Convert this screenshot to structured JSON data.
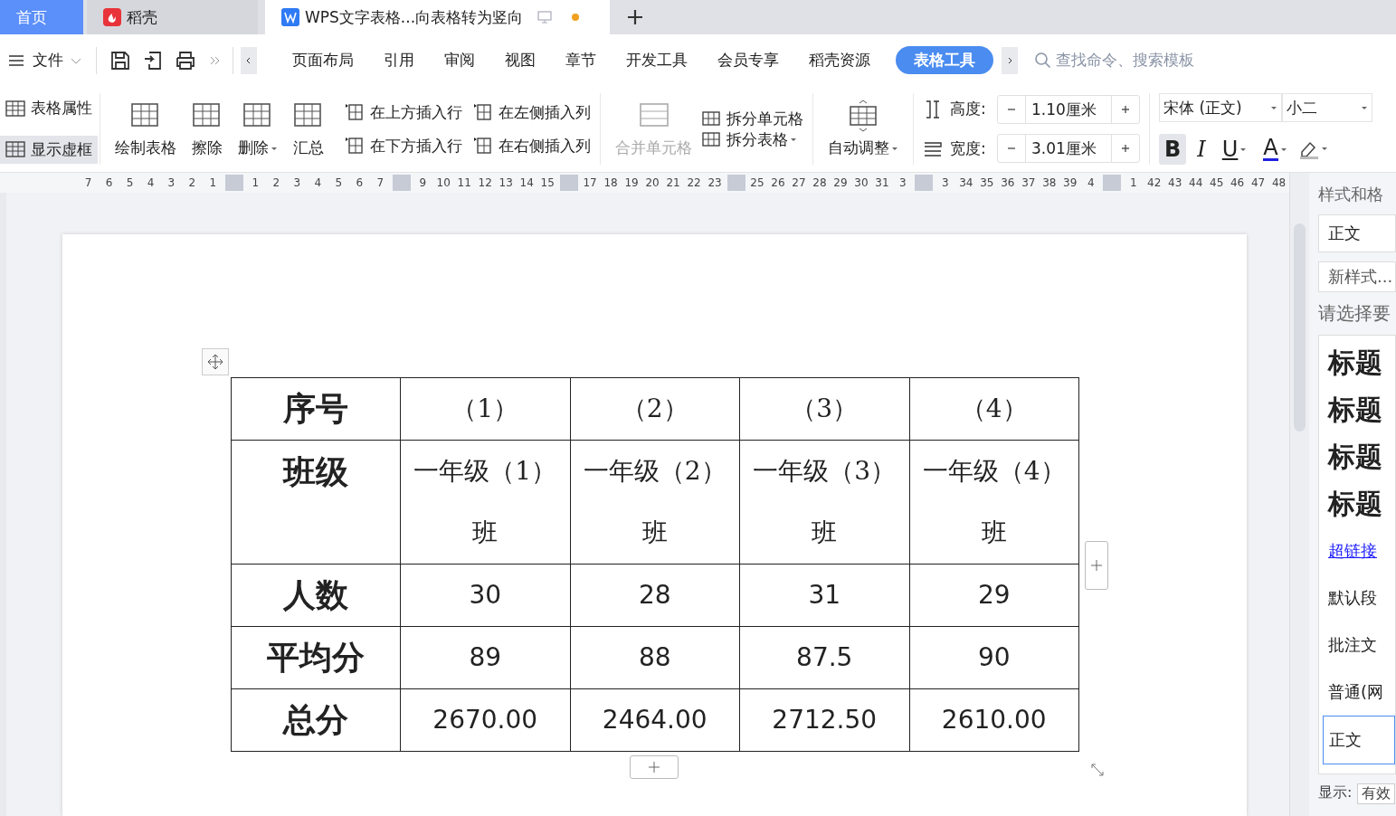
{
  "tabs": [
    {
      "label": "首页",
      "kind": "home",
      "selected": false
    },
    {
      "label": "稻壳",
      "kind": "app",
      "selected": false
    },
    {
      "label": "WPS文字表格...向表格转为竖向",
      "kind": "document",
      "selected": true,
      "unsaved": true
    }
  ],
  "menu": {
    "file": "文件",
    "items": [
      {
        "label": "页面布局",
        "selected": false
      },
      {
        "label": "引用",
        "selected": false
      },
      {
        "label": "审阅",
        "selected": false
      },
      {
        "label": "视图",
        "selected": false
      },
      {
        "label": "章节",
        "selected": false
      },
      {
        "label": "开发工具",
        "selected": false
      },
      {
        "label": "会员专享",
        "selected": false
      },
      {
        "label": "稻壳资源",
        "selected": false
      },
      {
        "label": "表格工具",
        "selected": true
      }
    ],
    "search": {
      "placeholder": "查找命令、搜索模板"
    }
  },
  "ribbon": {
    "toggles": [
      {
        "label": "表格属性",
        "selected": false
      },
      {
        "label": "显示虚框",
        "selected": true
      }
    ],
    "big_buttons": [
      {
        "label": "绘制表格",
        "dropdown": false
      },
      {
        "label": "擦除",
        "dropdown": false
      },
      {
        "label": "删除",
        "dropdown": true
      },
      {
        "label": "汇总",
        "dropdown": false
      }
    ],
    "insert_buttons": [
      "在上方插入行",
      "在左侧插入列",
      "在下方插入行",
      "在右侧插入列"
    ],
    "merge": {
      "label": "合并单元格",
      "disabled": true
    },
    "split_buttons": [
      {
        "label": "拆分单元格",
        "dropdown": false
      },
      {
        "label": "拆分表格",
        "dropdown": true
      }
    ],
    "auto_fit": {
      "label": "自动调整",
      "dropdown": true
    },
    "size_fields": [
      {
        "label": "高度:",
        "value": "1.10厘米"
      },
      {
        "label": "宽度:",
        "value": "3.01厘米"
      }
    ],
    "font": {
      "family": "宋体 (正文)",
      "size": "小二"
    },
    "format_buttons": [
      {
        "label": "B",
        "selected": true,
        "dropdown": false
      },
      {
        "label": "I",
        "selected": false,
        "dropdown": false
      },
      {
        "label": "U",
        "selected": false,
        "dropdown": true
      },
      {
        "label": "A",
        "selected": false,
        "dropdown": true
      }
    ]
  },
  "ruler": [
    [
      "7",
      "6",
      "5",
      "4",
      "3",
      "2",
      "1"
    ],
    [
      "1",
      "2",
      "3",
      "4",
      "5",
      "6",
      "7"
    ],
    [
      "9",
      "10",
      "11",
      "12",
      "13",
      "14",
      "15"
    ],
    [
      "17",
      "18",
      "19",
      "20",
      "21",
      "22",
      "23"
    ],
    [
      "25",
      "26",
      "27",
      "28",
      "29",
      "30",
      "31",
      "3"
    ],
    [
      "3",
      "34",
      "35",
      "36",
      "37",
      "38",
      "39",
      "4"
    ],
    [
      "1",
      "42",
      "43",
      "44",
      "45",
      "46",
      "47",
      "48"
    ]
  ],
  "table": {
    "rows": [
      {
        "header": "序号",
        "cells": [
          "（1）",
          "（2）",
          "（3）",
          "（4）"
        ]
      },
      {
        "header": "班级",
        "cells": [
          "一年级（1）班",
          "一年级（2）班",
          "一年级（3）班",
          "一年级（4）班"
        ]
      },
      {
        "header": "人数",
        "cells": [
          "30",
          "28",
          "31",
          "29"
        ]
      },
      {
        "header": "平均分",
        "cells": [
          "89",
          "88",
          "87.5",
          "90"
        ]
      },
      {
        "header": "总分",
        "cells": [
          "2670.00",
          "2464.00",
          "2712.50",
          "2610.00"
        ]
      }
    ]
  },
  "styles_panel": {
    "title": "样式和格",
    "current": "正文",
    "new_style": "新样式...",
    "prompt": "请选择要",
    "items": [
      {
        "label": "标题",
        "kind": "heading",
        "selected": false
      },
      {
        "label": "标题",
        "kind": "heading",
        "selected": false
      },
      {
        "label": "标题",
        "kind": "heading",
        "selected": false
      },
      {
        "label": "标题",
        "kind": "heading",
        "selected": false
      },
      {
        "label": "超链接",
        "kind": "link",
        "selected": false
      },
      {
        "label": "默认段",
        "kind": "plain",
        "selected": false
      },
      {
        "label": "批注文",
        "kind": "plain",
        "selected": false
      },
      {
        "label": "普通(网",
        "kind": "plain",
        "selected": false
      },
      {
        "label": "正文",
        "kind": "plain",
        "selected": true
      }
    ],
    "show_label": "显示:",
    "show_value": "有效"
  }
}
